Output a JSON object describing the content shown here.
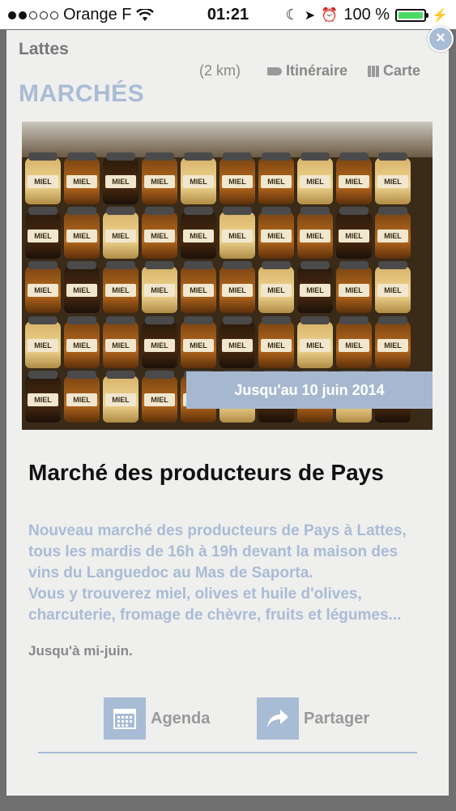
{
  "status_bar": {
    "carrier": "Orange F",
    "time": "01:21",
    "battery": "100 %"
  },
  "header": {
    "city": "Lattes",
    "distance": "(2 km)",
    "itinerary_label": "Itinéraire",
    "map_label": "Carte",
    "category": "MARCHÉS"
  },
  "close_label": "×",
  "event": {
    "date_badge": "Jusqu'au 10 juin 2014",
    "title": "Marché des producteurs de Pays",
    "description_lines": [
      "Nouveau marché des producteurs de Pays à Lattes,",
      "tous les mardis de 16h à 19h devant la maison des",
      "vins du Languedoc au Mas de Saporta.",
      "Vous y trouverez miel, olives et huile d'olives,",
      "charcuterie, fromage de chèvre, fruits et légumes..."
    ],
    "until": "Jusqu'à mi-juin."
  },
  "actions": {
    "agenda_label": "Agenda",
    "share_label": "Partager"
  },
  "colors": {
    "accent": "#a9bcd6",
    "panel": "#efefed",
    "overlay": "#6f6f6f"
  },
  "icons": [
    "wifi-icon",
    "moon-icon",
    "location-icon",
    "alarm-icon",
    "charging-icon",
    "tag-icon",
    "map-icon",
    "calendar-icon",
    "share-arrow-icon",
    "close-icon"
  ]
}
